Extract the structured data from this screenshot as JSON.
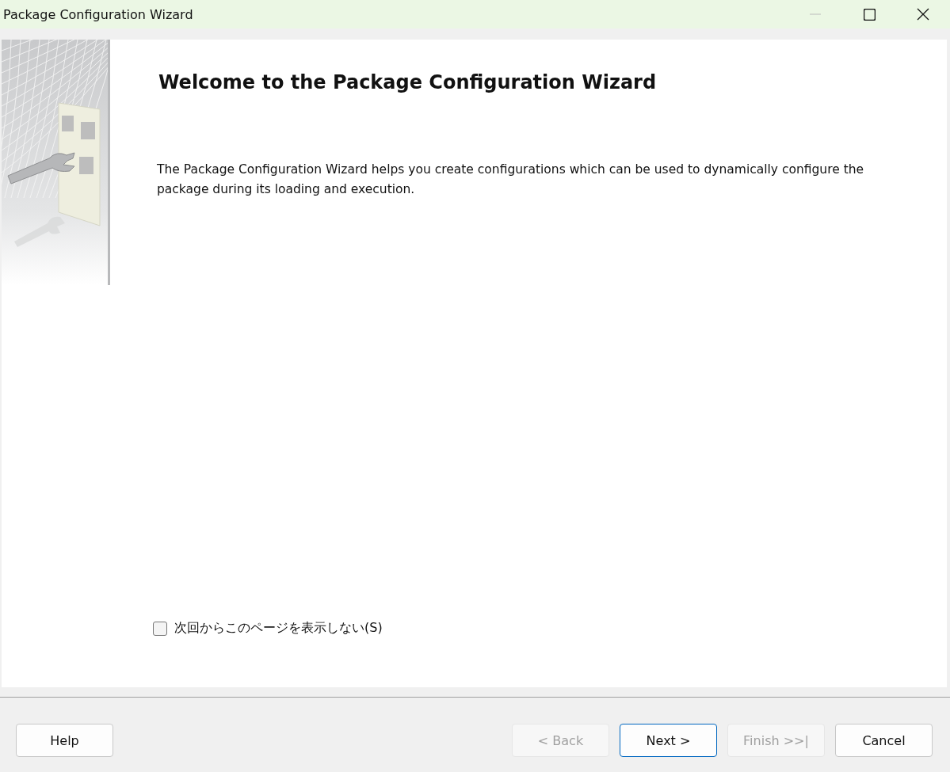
{
  "window": {
    "title": "Package Configuration Wizard",
    "minimize_disabled": true
  },
  "page": {
    "heading": "Welcome to the Package Configuration Wizard",
    "description": "The Package Configuration Wizard helps you create configurations which can be used to dynamically configure the package during its loading and execution."
  },
  "checkbox": {
    "label": "次回からこのページを表示しない(S)",
    "checked": false
  },
  "buttons": [
    {
      "label": "Help",
      "disabled": false,
      "default": false
    },
    {
      "label": "< Back",
      "disabled": true,
      "default": false
    },
    {
      "label": "Next >",
      "disabled": false,
      "default": true
    },
    {
      "label": "Finish >>|",
      "disabled": true,
      "default": false
    },
    {
      "label": "Cancel",
      "disabled": false,
      "default": false
    }
  ]
}
